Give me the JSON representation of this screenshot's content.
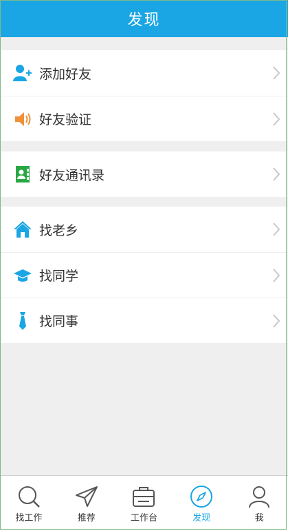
{
  "header": {
    "title": "发现"
  },
  "groups": [
    {
      "items": [
        {
          "label": "添加好友",
          "icon": "add-friend-icon"
        },
        {
          "label": "好友验证",
          "icon": "speaker-icon"
        }
      ]
    },
    {
      "items": [
        {
          "label": "好友通讯录",
          "icon": "contacts-book-icon"
        }
      ]
    },
    {
      "items": [
        {
          "label": "找老乡",
          "icon": "home-icon"
        },
        {
          "label": "找同学",
          "icon": "graduation-cap-icon"
        },
        {
          "label": "找同事",
          "icon": "tie-icon"
        }
      ]
    }
  ],
  "tabs": [
    {
      "label": "找工作",
      "icon": "search-icon",
      "active": false
    },
    {
      "label": "推荐",
      "icon": "paper-plane-icon",
      "active": false
    },
    {
      "label": "工作台",
      "icon": "briefcase-icon",
      "active": false
    },
    {
      "label": "发现",
      "icon": "compass-icon",
      "active": true
    },
    {
      "label": "我",
      "icon": "person-icon",
      "active": false
    }
  ],
  "colors": {
    "accent": "#1aa6e4",
    "speaker": "#f0913a",
    "contacts": "#27a844"
  }
}
